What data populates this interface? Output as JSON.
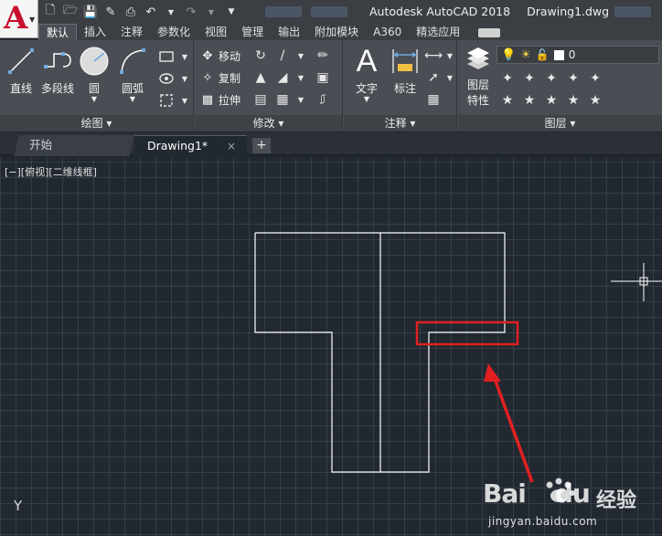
{
  "titlebar": {
    "app_name": "Autodesk AutoCAD 2018",
    "file_name": "Drawing1.dwg",
    "app_letter": "A"
  },
  "quick_access": {
    "icons": [
      "new-icon",
      "open-icon",
      "save-icon",
      "save-as-icon",
      "print-icon",
      "undo-icon",
      "redo-icon",
      "customize-icon"
    ]
  },
  "ribbon_tabs": [
    {
      "label": "默认",
      "active": true
    },
    {
      "label": "插入"
    },
    {
      "label": "注释"
    },
    {
      "label": "参数化"
    },
    {
      "label": "视图"
    },
    {
      "label": "管理"
    },
    {
      "label": "输出"
    },
    {
      "label": "附加模块"
    },
    {
      "label": "A360"
    },
    {
      "label": "精选应用"
    }
  ],
  "panels": {
    "draw": {
      "title": "绘图 ▾",
      "line": "直线",
      "polyline": "多段线",
      "circle": "圆",
      "arc": "圆弧"
    },
    "modify": {
      "title": "修改 ▾",
      "move": "移动",
      "copy": "复制",
      "stretch": "拉伸"
    },
    "annotation": {
      "title": "注释 ▾",
      "text": "文字",
      "dimension": "标注"
    },
    "layers": {
      "title": "图层 ▾",
      "properties_line1": "图层",
      "properties_line2": "特性",
      "current_layer": "0"
    }
  },
  "doc_tabs": {
    "start": "开始",
    "drawing": "Drawing1*",
    "close_glyph": "×",
    "new_glyph": "+"
  },
  "viewport": {
    "label": "[−][俯视][二维线框]"
  },
  "ucs": {
    "y_label": "Y"
  },
  "watermark": {
    "brand": "Bai",
    "brand_du": "du",
    "cn": "经验",
    "url": "jingyan.baidu.com"
  },
  "colors": {
    "canvas": "#212830",
    "highlight_box": "#e02020",
    "arrow": "#e02020",
    "geometry": "#ffffff",
    "app_red": "#c8102e"
  }
}
